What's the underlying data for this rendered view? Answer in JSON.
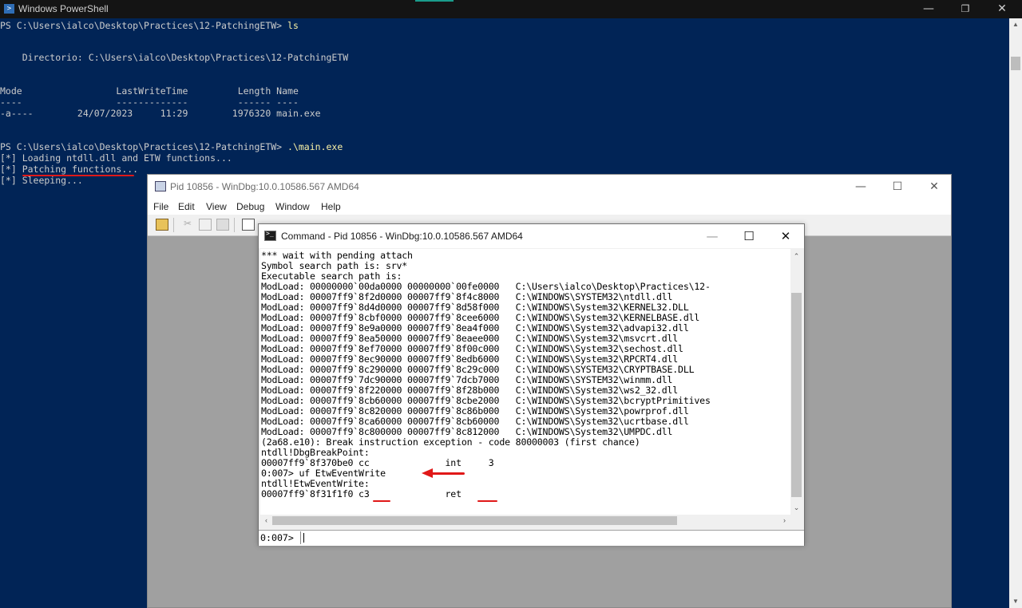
{
  "powershell": {
    "title": "Windows PowerShell",
    "prompt1": "PS C:\\Users\\ialco\\Desktop\\Practices\\12-PatchingETW> ",
    "cmd1": "ls",
    "dir_line": "    Directorio: C:\\Users\\ialco\\Desktop\\Practices\\12-PatchingETW",
    "header": "Mode                 LastWriteTime         Length Name",
    "underline": "----                 -------------         ------ ----",
    "row": "-a----        24/07/2023     11:29        1976320 main.exe",
    "prompt2": "PS C:\\Users\\ialco\\Desktop\\Practices\\12-PatchingETW> ",
    "cmd2": ".\\main.exe",
    "out1": "[*] Loading ntdll.dll and ETW functions...",
    "out2": "[*] Patching functions...",
    "out3": "[*] Sleeping..."
  },
  "windbg": {
    "title": "Pid 10856 - WinDbg:10.0.10586.567 AMD64",
    "menu": [
      "File",
      "Edit",
      "View",
      "Debug",
      "Window",
      "Help"
    ]
  },
  "command_window": {
    "title": "Command - Pid 10856 - WinDbg:10.0.10586.567 AMD64",
    "lines": [
      "*** wait with pending attach",
      "Symbol search path is: srv*",
      "Executable search path is:",
      "ModLoad: 00000000`00da0000 00000000`00fe0000   C:\\Users\\ialco\\Desktop\\Practices\\12-",
      "ModLoad: 00007ff9`8f2d0000 00007ff9`8f4c8000   C:\\WINDOWS\\SYSTEM32\\ntdll.dll",
      "ModLoad: 00007ff9`8d4d0000 00007ff9`8d58f000   C:\\WINDOWS\\System32\\KERNEL32.DLL",
      "ModLoad: 00007ff9`8cbf0000 00007ff9`8cee6000   C:\\WINDOWS\\System32\\KERNELBASE.dll",
      "ModLoad: 00007ff9`8e9a0000 00007ff9`8ea4f000   C:\\WINDOWS\\System32\\advapi32.dll",
      "ModLoad: 00007ff9`8ea50000 00007ff9`8eaee000   C:\\WINDOWS\\System32\\msvcrt.dll",
      "ModLoad: 00007ff9`8ef70000 00007ff9`8f00c000   C:\\WINDOWS\\System32\\sechost.dll",
      "ModLoad: 00007ff9`8ec90000 00007ff9`8edb6000   C:\\WINDOWS\\System32\\RPCRT4.dll",
      "ModLoad: 00007ff9`8c290000 00007ff9`8c29c000   C:\\WINDOWS\\SYSTEM32\\CRYPTBASE.DLL",
      "ModLoad: 00007ff9`7dc90000 00007ff9`7dcb7000   C:\\WINDOWS\\SYSTEM32\\winmm.dll",
      "ModLoad: 00007ff9`8f220000 00007ff9`8f28b000   C:\\WINDOWS\\System32\\ws2_32.dll",
      "ModLoad: 00007ff9`8cb60000 00007ff9`8cbe2000   C:\\WINDOWS\\System32\\bcryptPrimitives",
      "ModLoad: 00007ff9`8c820000 00007ff9`8c86b000   C:\\WINDOWS\\System32\\powrprof.dll",
      "ModLoad: 00007ff9`8ca60000 00007ff9`8cb60000   C:\\WINDOWS\\System32\\ucrtbase.dll",
      "ModLoad: 00007ff9`8c800000 00007ff9`8c812000   C:\\WINDOWS\\System32\\UMPDC.dll",
      "(2a68.e10): Break instruction exception - code 80000003 (first chance)",
      "ntdll!DbgBreakPoint:",
      "00007ff9`8f370be0 cc              int     3",
      "0:007> uf EtwEventWrite",
      "ntdll!EtwEventWrite:",
      "00007ff9`8f31f1f0 c3              ret"
    ],
    "prompt": "0:007>"
  }
}
